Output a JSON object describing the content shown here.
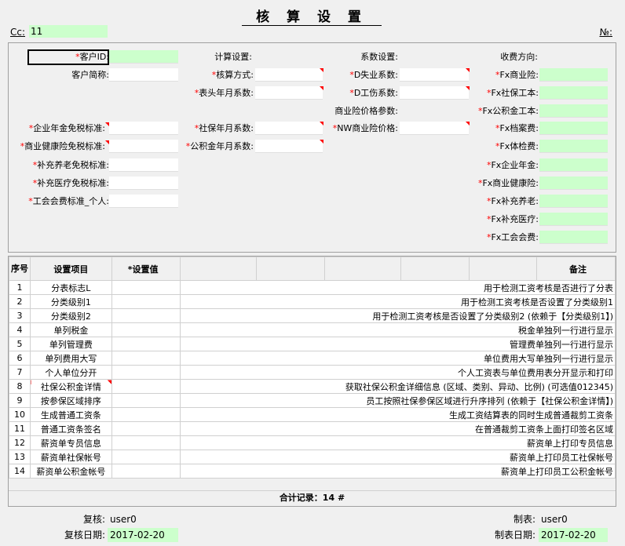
{
  "header": {
    "title": "核 算 设 置",
    "cc_label": "Cc:",
    "cc_value": "11",
    "no_label": "№:"
  },
  "form": {
    "col1": [
      {
        "label": "客户ID:",
        "required": true,
        "flag": false
      },
      {
        "label": "客户简称:",
        "required": false,
        "flag": false
      },
      {
        "label": "企业年金免税标准:",
        "required": true,
        "flag": true
      },
      {
        "label": "商业健康险免税标准:",
        "required": true,
        "flag": true
      },
      {
        "label": "补充养老免税标准:",
        "required": true,
        "flag": false
      },
      {
        "label": "补充医疗免税标准:",
        "required": true,
        "flag": false
      },
      {
        "label": "工会会费标准_个人:",
        "required": true,
        "flag": false
      }
    ],
    "col2_header": "计算设置:",
    "col2": [
      {
        "label": "核算方式:",
        "required": true
      },
      {
        "label": "表头年月系数:",
        "required": true
      },
      {
        "label": "社保年月系数:",
        "required": true
      },
      {
        "label": "公积金年月系数:",
        "required": true
      }
    ],
    "col3_header": "系数设置:",
    "col3": [
      {
        "label": "D失业系数:",
        "required": true
      },
      {
        "label": "D工伤系数:",
        "required": true
      },
      {
        "label": "商业险价格参数:",
        "required": false
      },
      {
        "label": "NW商业险价格:",
        "required": true
      }
    ],
    "col4_header": "收费方向:",
    "col4": [
      {
        "label": "Fx商业险:",
        "required": true
      },
      {
        "label": "Fx社保工本:",
        "required": true
      },
      {
        "label": "Fx公积金工本:",
        "required": true
      },
      {
        "label": "Fx档案费:",
        "required": true
      },
      {
        "label": "Fx体检费:",
        "required": true
      },
      {
        "label": "Fx企业年金:",
        "required": true
      },
      {
        "label": "Fx商业健康险:",
        "required": true
      },
      {
        "label": "Fx补充养老:",
        "required": true
      },
      {
        "label": "Fx补充医疗:",
        "required": true
      },
      {
        "label": "Fx工会会费:",
        "required": true
      }
    ]
  },
  "grid": {
    "headers": {
      "seq": "序号",
      "item": "设置项目",
      "value": "*设置值",
      "remark": "备注"
    },
    "rows": [
      {
        "seq": "1",
        "item": "分表标志L",
        "remark": "用于检测工资考核是否进行了分表"
      },
      {
        "seq": "2",
        "item": "分类级别1",
        "remark": "用于检测工资考核是否设置了分类级别1"
      },
      {
        "seq": "3",
        "item": "分类级别2",
        "remark": "用于检测工资考核是否设置了分类级别2 (依赖于【分类级别1】)"
      },
      {
        "seq": "4",
        "item": "单列税金",
        "remark": "税金单独列一行进行显示"
      },
      {
        "seq": "5",
        "item": "单列管理费",
        "remark": "管理费单独列一行进行显示"
      },
      {
        "seq": "6",
        "item": "单列费用大写",
        "remark": "单位费用大写单独列一行进行显示"
      },
      {
        "seq": "7",
        "item": "个人单位分开",
        "remark": "个人工资表与单位费用表分开显示和打印"
      },
      {
        "seq": "8",
        "item": "社保公积金详情",
        "remark": "获取社保公积金详细信息 (区域、类别、异动、比例) (可选值012345)"
      },
      {
        "seq": "9",
        "item": "按参保区域排序",
        "remark": "员工按照社保参保区域进行升序排列 (依赖于【社保公积金详情】)"
      },
      {
        "seq": "10",
        "item": "生成普通工资条",
        "remark": "生成工资结算表的同时生成普通裁剪工资条"
      },
      {
        "seq": "11",
        "item": "普通工资条签名",
        "remark": "在普通裁剪工资条上面打印签名区域"
      },
      {
        "seq": "12",
        "item": "薪资单专员信息",
        "remark": "薪资单上打印专员信息"
      },
      {
        "seq": "13",
        "item": "薪资单社保帐号",
        "remark": "薪资单上打印员工社保帐号"
      },
      {
        "seq": "14",
        "item": "薪资单公积金帐号",
        "remark": "薪资单上打印员工公积金帐号"
      }
    ],
    "summary": "合计记录：14 #"
  },
  "footer": {
    "review_label": "复核:",
    "review_value": "user0",
    "review_date_label": "复核日期:",
    "review_date_value": "2017-02-20",
    "maker_label": "制表:",
    "maker_value": "user0",
    "make_date_label": "制表日期:",
    "make_date_value": "2017-02-20"
  },
  "colors": {
    "green_field": "#ccffcc",
    "required_mark": "#ff0000"
  }
}
